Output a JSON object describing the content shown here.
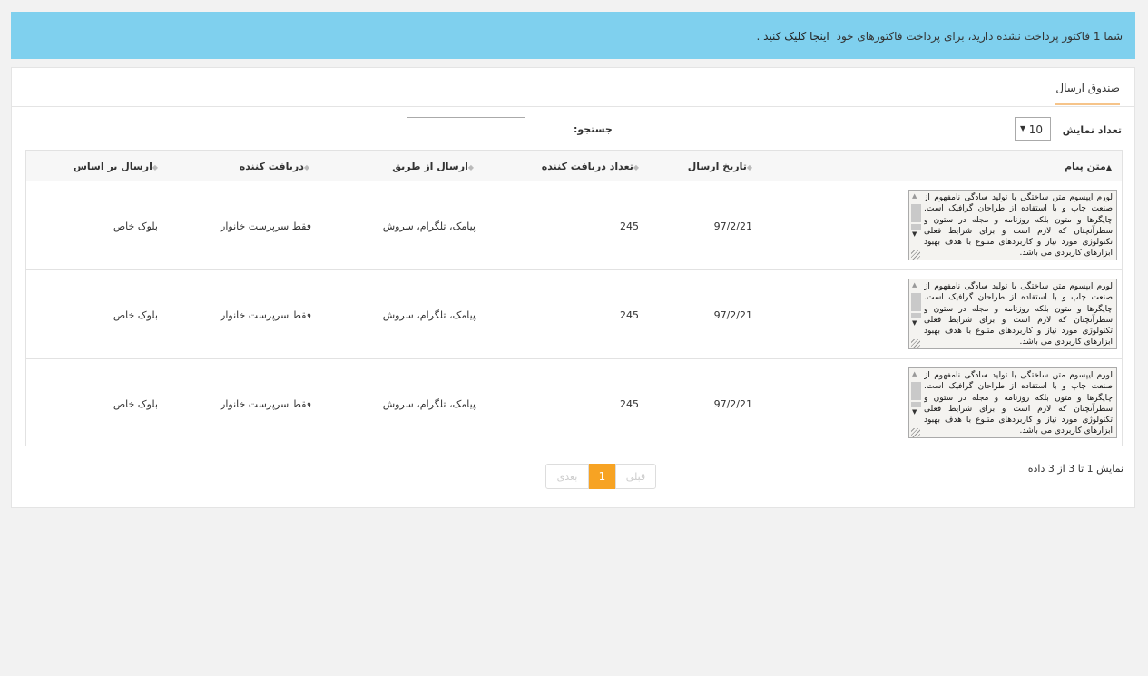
{
  "alert": {
    "text": "شما 1 فاکتور پرداخت نشده دارید، برای پرداخت فاکتورهای خود",
    "link": "اینجا کلیک کنید",
    "suffix": " ."
  },
  "panel": {
    "tab": "صندوق ارسال",
    "length_label": "تعداد نمایش",
    "length_value": "10",
    "search_label": "جستجو:",
    "search_value": ""
  },
  "table": {
    "headers": {
      "message": "متن پیام",
      "date": "تاریخ ارسال",
      "count": "تعداد دریافت کننده",
      "via": "ارسال از طریق",
      "receiver": "دریافت کننده",
      "basis": "ارسال بر اساس"
    },
    "rows": [
      {
        "message": "لورم ایپسوم متن ساختگی با تولید سادگی نامفهوم از صنعت چاپ و با استفاده از طراحان گرافیک است. چاپگرها و متون بلکه روزنامه و مجله در ستون و سطرآنچنان که لازم است و برای شرایط فعلی تکنولوژی مورد نیاز و کاربردهای متنوع با هدف بهبود ابزارهای کاربردی می باشد.",
        "date": "97/2/21",
        "count": "245",
        "via": "پیامک، تلگرام، سروش",
        "receiver": "فقط سرپرست خانوار",
        "basis": "بلوک خاص"
      },
      {
        "message": "لورم ایپسوم متن ساختگی با تولید سادگی نامفهوم از صنعت چاپ و با استفاده از طراحان گرافیک است. چاپگرها و متون بلکه روزنامه و مجله در ستون و سطرآنچنان که لازم است و برای شرایط فعلی تکنولوژی مورد نیاز و کاربردهای متنوع با هدف بهبود ابزارهای کاربردی می باشد.",
        "date": "97/2/21",
        "count": "245",
        "via": "پیامک، تلگرام، سروش",
        "receiver": "فقط سرپرست خانوار",
        "basis": "بلوک خاص"
      },
      {
        "message": "لورم ایپسوم متن ساختگی با تولید سادگی نامفهوم از صنعت چاپ و با استفاده از طراحان گرافیک است. چاپگرها و متون بلکه روزنامه و مجله در ستون و سطرآنچنان که لازم است و برای شرایط فعلی تکنولوژی مورد نیاز و کاربردهای متنوع با هدف بهبود ابزارهای کاربردی می باشد.",
        "date": "97/2/21",
        "count": "245",
        "via": "پیامک، تلگرام، سروش",
        "receiver": "فقط سرپرست خانوار",
        "basis": "بلوک خاص"
      }
    ]
  },
  "footer": {
    "info": "نمایش 1 تا 3 از 3 داده",
    "prev": "قبلی",
    "current_page": "1",
    "next": "بعدی"
  },
  "colors": {
    "alert_bg": "#7fd0ee",
    "accent": "#f7a323"
  }
}
